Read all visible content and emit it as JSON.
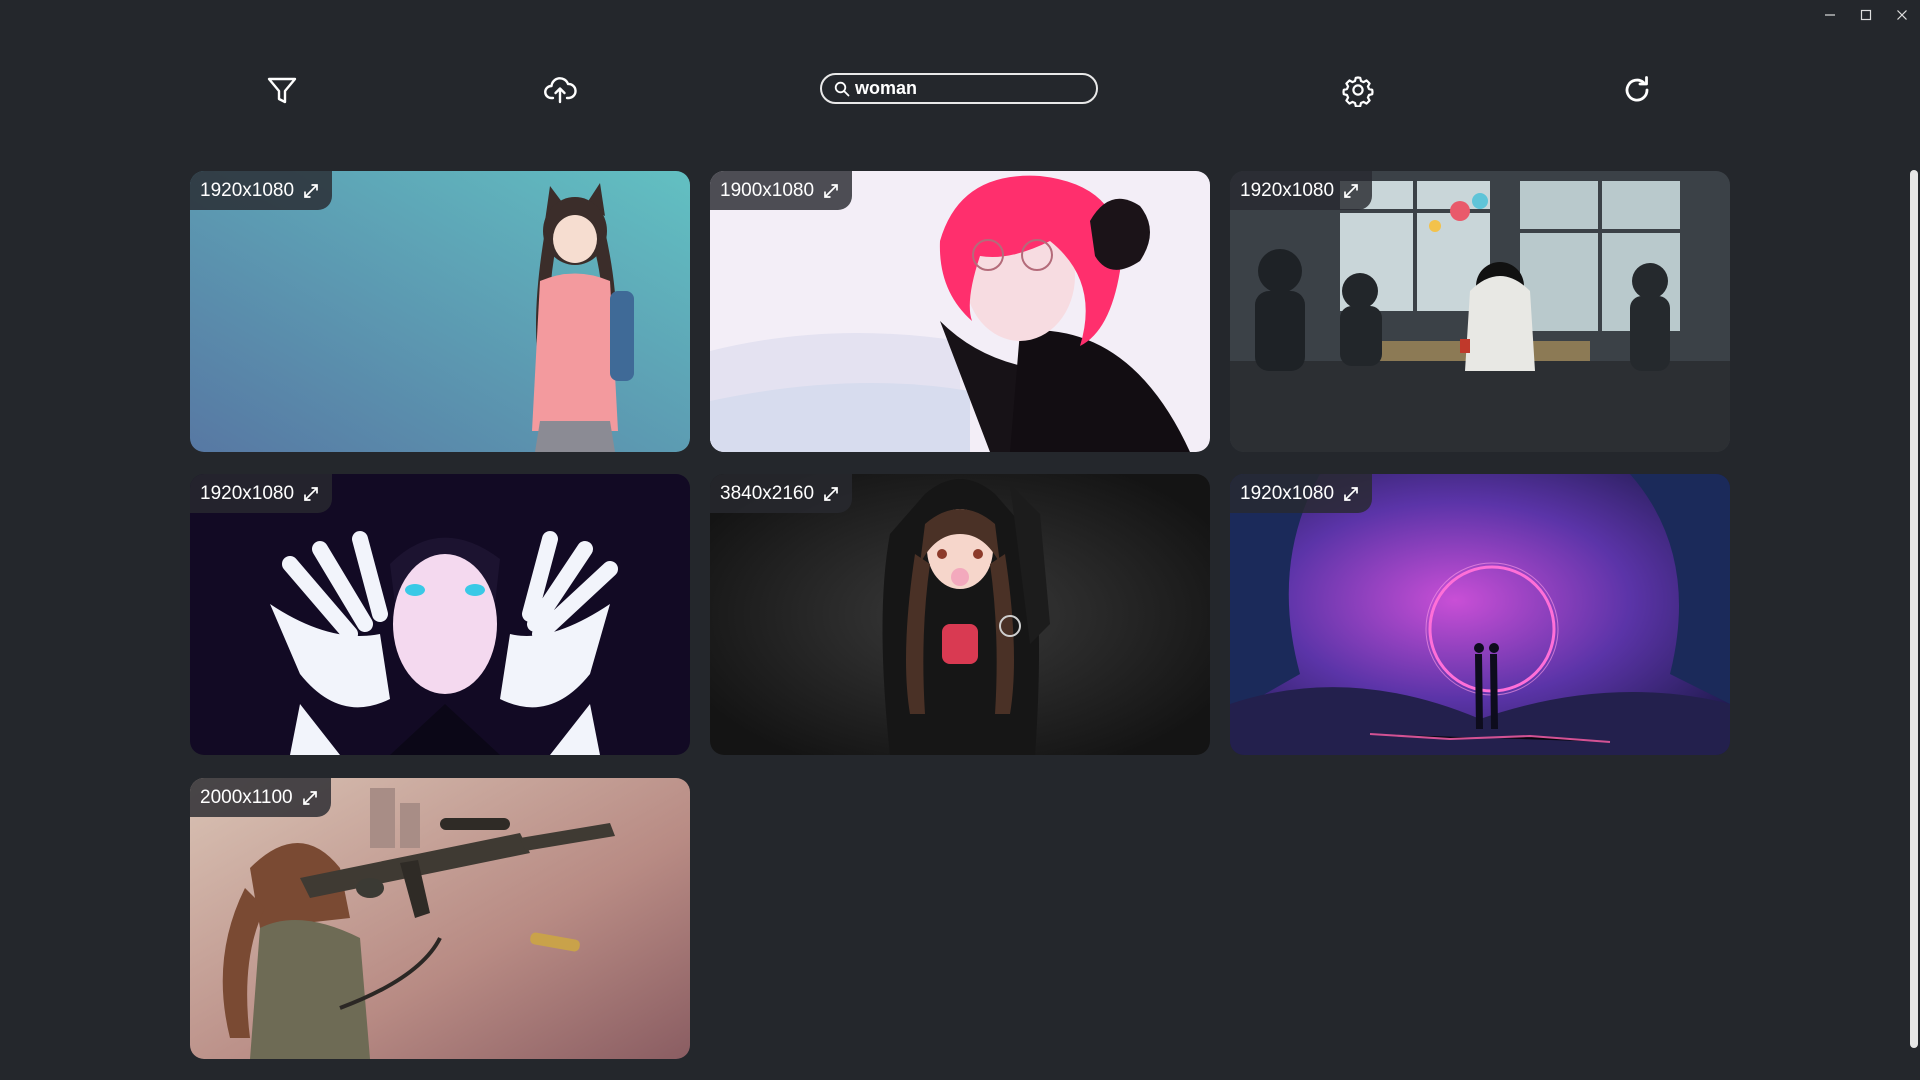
{
  "window": {
    "controls": [
      "minimize-icon",
      "maximize-icon",
      "close-icon"
    ]
  },
  "toolbar": {
    "icons": [
      "filter-icon",
      "cloud-upload-icon",
      "settings-gear-icon",
      "refresh-icon"
    ],
    "search": {
      "value": "woman",
      "icon": "search-icon"
    }
  },
  "wallpapers": [
    {
      "resolution": "1920x1080",
      "subject": "cat-eared girl in pink cardigan on teal"
    },
    {
      "resolution": "1900x1080",
      "subject": "pink-haired girl with glasses and black rose"
    },
    {
      "resolution": "1920x1080",
      "subject": "classroom with students and flowers"
    },
    {
      "resolution": "1920x1080",
      "subject": "girl framing eyes with hands on dark purple"
    },
    {
      "resolution": "3840x2160",
      "subject": "girl in black bunny hoodie blowing bubble gum"
    },
    {
      "resolution": "1920x1080",
      "subject": "couple before glowing ring in cosmic cave"
    },
    {
      "resolution": "2000x1100",
      "subject": "soldier girl aiming rifle"
    }
  ],
  "colors": {
    "background": "#24272c",
    "badge": "#282a30",
    "icon": "#ffffff"
  }
}
